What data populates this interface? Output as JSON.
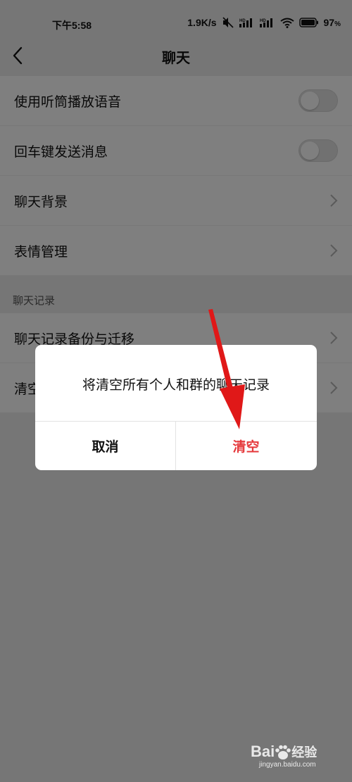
{
  "status_bar": {
    "time": "下午5:58",
    "speed": "1.9K/s",
    "battery": "97"
  },
  "nav": {
    "title": "聊天",
    "back_icon": "chevron-left-icon"
  },
  "settings_group": [
    {
      "label": "使用听筒播放语音",
      "control": "toggle",
      "on": false
    },
    {
      "label": "回车键发送消息",
      "control": "toggle",
      "on": false
    },
    {
      "label": "聊天背景",
      "control": "chevron"
    },
    {
      "label": "表情管理",
      "control": "chevron"
    }
  ],
  "history_section": {
    "header": "聊天记录",
    "items": [
      {
        "label": "聊天记录备份与迁移",
        "control": "chevron"
      },
      {
        "label": "清空聊天记录",
        "control": "chevron"
      }
    ]
  },
  "dialog": {
    "message": "将清空所有个人和群的聊天记录",
    "cancel_label": "取消",
    "confirm_label": "清空"
  },
  "watermark": {
    "logo": "Bai  经验",
    "site": "jingyan.baidu.com"
  },
  "colors": {
    "accent_red": "#e5383b",
    "background": "#ededed"
  }
}
